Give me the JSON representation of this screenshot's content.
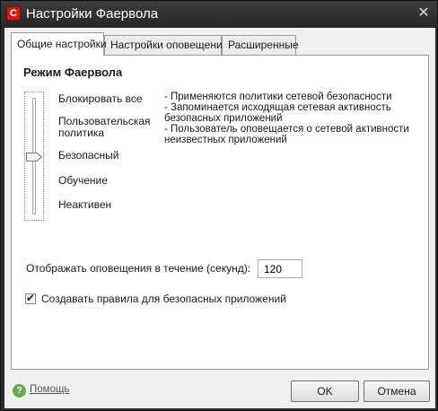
{
  "window": {
    "title": "Настройки Фаервола",
    "app_icon_letter": "C",
    "close_glyph": "✕"
  },
  "tabs": [
    {
      "label": "Общие настройки",
      "active": true
    },
    {
      "label": "Настройки оповещений",
      "active": false
    },
    {
      "label": "Расширенные",
      "active": false
    }
  ],
  "mode": {
    "title": "Режим Фаервола",
    "levels": [
      {
        "label": "Блокировать все"
      },
      {
        "label": "Пользовательская политика"
      },
      {
        "label": "Безопасный"
      },
      {
        "label": "Обучение"
      },
      {
        "label": "Неактивен"
      }
    ],
    "selected_level": "Безопасный",
    "description": [
      "- Применяются политики сетевой безопасности",
      "- Запоминается исходящая сетевая активность",
      "безопасных приложений",
      "- Пользователь оповещается о сетевой активности",
      "неизвестных приложений"
    ]
  },
  "notify": {
    "label": "Отображать оповещения в течение (секунд):",
    "value": "120"
  },
  "safe_rules": {
    "label": "Создавать правила для безопасных приложений",
    "checked": true
  },
  "footer": {
    "help_label": "Помощь",
    "help_icon_glyph": "?",
    "ok_label": "OK",
    "cancel_label": "Отмена"
  },
  "colors": {
    "titlebar": "#2b2b2b",
    "app_icon": "#d11a1a",
    "help_icon": "#6aa84f"
  }
}
